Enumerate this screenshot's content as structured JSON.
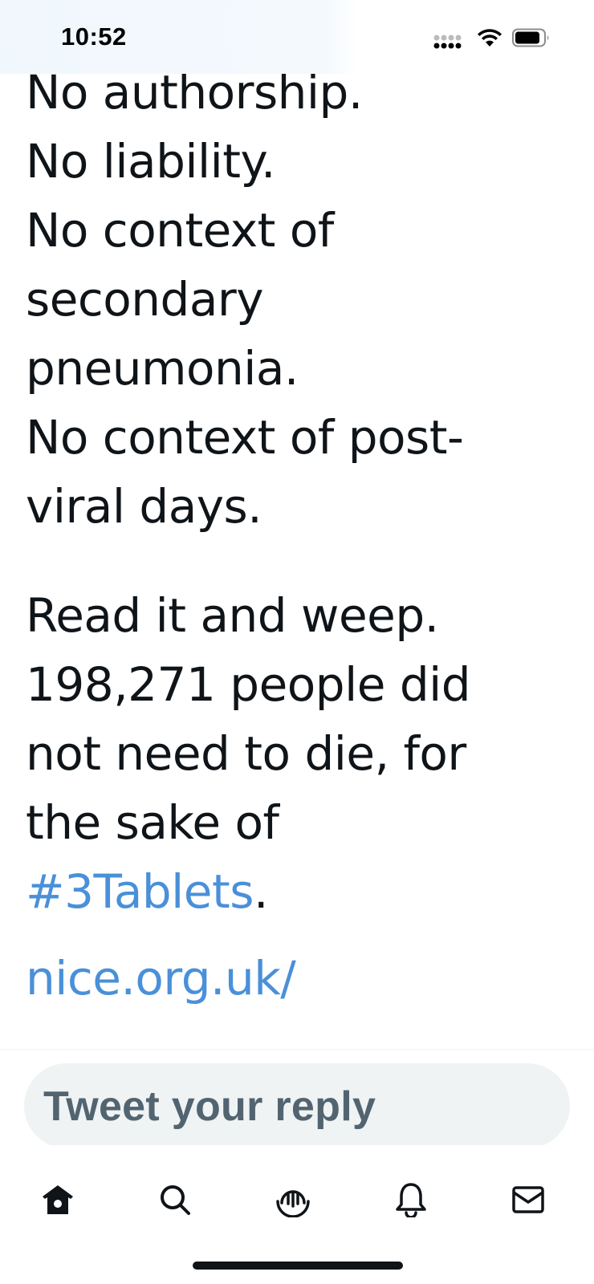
{
  "status_bar": {
    "time": "10:52"
  },
  "tweet": {
    "lines_group_1": [
      "No authorship.",
      "No liability.",
      "No context of",
      "secondary",
      "pneumonia.",
      "No context of post-",
      "viral days."
    ],
    "lines_group_2": [
      "Read it and weep.",
      "198,271 people did",
      "not need to die, for",
      "the sake of"
    ],
    "hashtag": "#3Tablets",
    "hashtag_suffix": ".",
    "link": "nice.org.uk/"
  },
  "reply": {
    "placeholder": "Tweet your reply"
  },
  "tab_bar": {
    "items": [
      {
        "icon": "home-icon",
        "active": true
      },
      {
        "icon": "search-icon",
        "active": false
      },
      {
        "icon": "spaces-icon",
        "active": false
      },
      {
        "icon": "notifications-icon",
        "active": false
      },
      {
        "icon": "messages-icon",
        "active": false
      }
    ]
  },
  "colors": {
    "text": "#0f1419",
    "link": "#4a90d9",
    "placeholder": "#536471",
    "input_bg": "#eff3f4"
  }
}
